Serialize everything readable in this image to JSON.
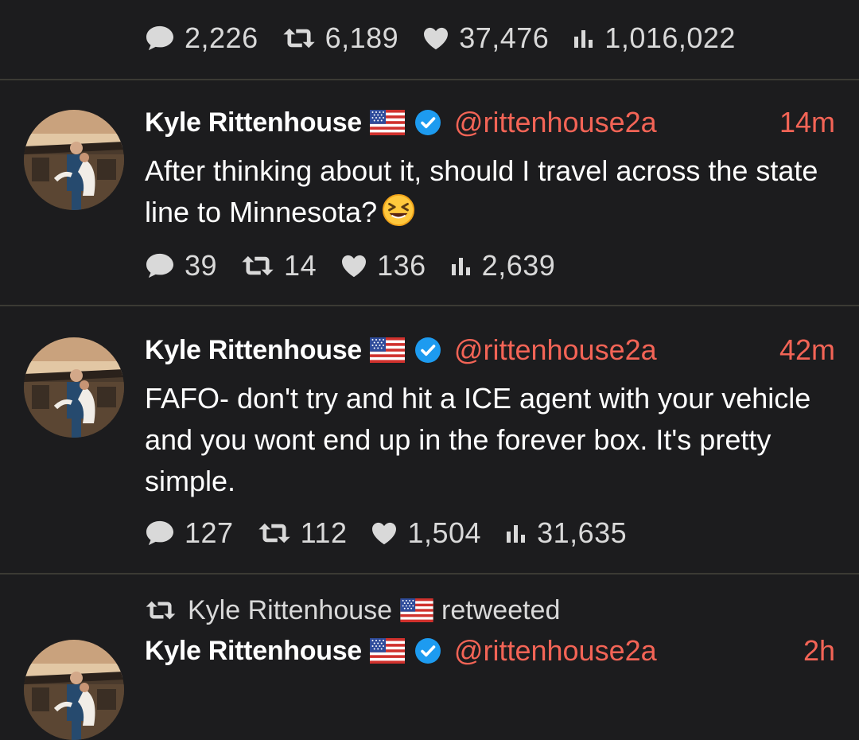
{
  "top_tweet": {
    "stats": {
      "replies": "2,226",
      "retweets": "6,189",
      "likes": "37,476",
      "views": "1,016,022"
    }
  },
  "tweets": [
    {
      "name": "Kyle Rittenhouse",
      "flag": "us-flag",
      "verified": true,
      "handle": "@rittenhouse2a",
      "time": "14m",
      "text": "After thinking about it, should I travel across the state line to Minnesota?",
      "emoji": "grinning-squinting-face",
      "stats": {
        "replies": "39",
        "retweets": "14",
        "likes": "136",
        "views": "2,639"
      }
    },
    {
      "name": "Kyle Rittenhouse",
      "flag": "us-flag",
      "verified": true,
      "handle": "@rittenhouse2a",
      "time": "42m",
      "text": "FAFO- don't try and hit a ICE agent with your vehicle and you wont end up in the forever box. It's pretty simple.",
      "stats": {
        "replies": "127",
        "retweets": "112",
        "likes": "1,504",
        "views": "31,635"
      }
    }
  ],
  "retweet_banner": {
    "name": "Kyle Rittenhouse",
    "label": "retweeted"
  },
  "partial_tweet": {
    "name": "Kyle Rittenhouse",
    "handle": "@rittenhouse2a",
    "time": "2h"
  },
  "colors": {
    "background": "#1c1c1e",
    "accent": "#f36456",
    "verified": "#1d9bf0",
    "divider": "#3b3a34"
  }
}
